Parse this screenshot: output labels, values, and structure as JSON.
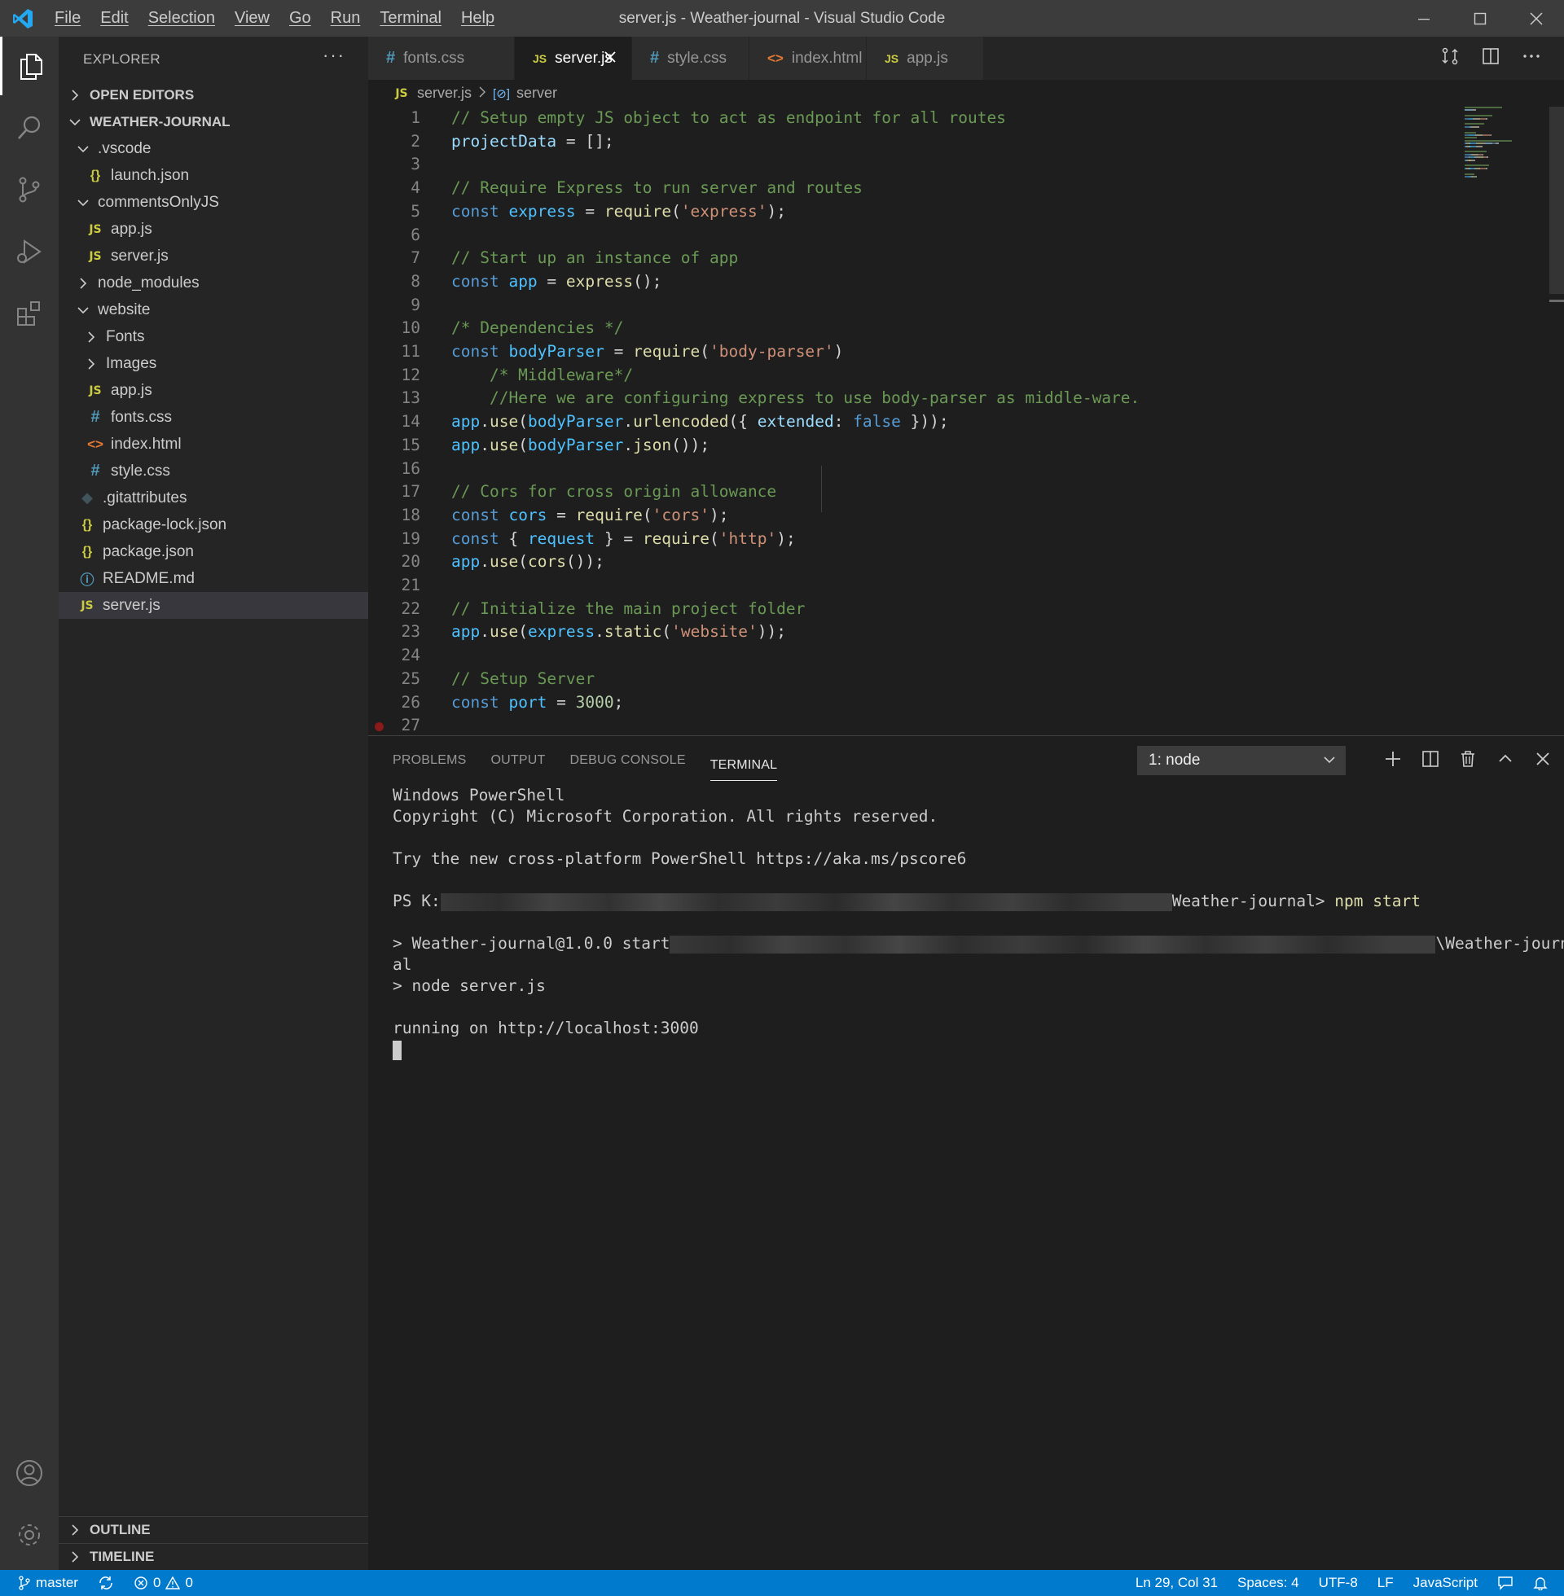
{
  "titlebar": {
    "menu": [
      "File",
      "Edit",
      "Selection",
      "View",
      "Go",
      "Run",
      "Terminal",
      "Help"
    ],
    "title": "server.js - Weather-journal - Visual Studio Code"
  },
  "sidebar": {
    "header": "EXPLORER",
    "more": "···",
    "open_editors": "OPEN EDITORS",
    "project": "WEATHER-JOURNAL",
    "tree": [
      {
        "label": ".vscode",
        "type": "folder-open",
        "indent": 1
      },
      {
        "label": "launch.json",
        "type": "json",
        "indent": 2
      },
      {
        "label": "commentsOnlyJS",
        "type": "folder-open",
        "indent": 1
      },
      {
        "label": "app.js",
        "type": "js",
        "indent": 2
      },
      {
        "label": "server.js",
        "type": "js",
        "indent": 2
      },
      {
        "label": "node_modules",
        "type": "folder-closed",
        "indent": 1
      },
      {
        "label": "website",
        "type": "folder-open",
        "indent": 1
      },
      {
        "label": "Fonts",
        "type": "folder-closed",
        "indent": 2
      },
      {
        "label": "Images",
        "type": "folder-closed",
        "indent": 2
      },
      {
        "label": "app.js",
        "type": "js",
        "indent": 2
      },
      {
        "label": "fonts.css",
        "type": "css",
        "indent": 2
      },
      {
        "label": "index.html",
        "type": "html",
        "indent": 2
      },
      {
        "label": "style.css",
        "type": "css",
        "indent": 2
      },
      {
        "label": ".gitattributes",
        "type": "git",
        "indent": 1
      },
      {
        "label": "package-lock.json",
        "type": "json",
        "indent": 1
      },
      {
        "label": "package.json",
        "type": "json",
        "indent": 1
      },
      {
        "label": "README.md",
        "type": "info",
        "indent": 1
      },
      {
        "label": "server.js",
        "type": "js",
        "indent": 1,
        "selected": true
      }
    ],
    "outline": "OUTLINE",
    "timeline": "TIMELINE"
  },
  "tabs": [
    {
      "label": "fonts.css",
      "type": "css",
      "active": false
    },
    {
      "label": "server.js",
      "type": "js",
      "active": true
    },
    {
      "label": "style.css",
      "type": "css",
      "active": false
    },
    {
      "label": "index.html",
      "type": "html",
      "active": false
    },
    {
      "label": "app.js",
      "type": "js",
      "active": false
    }
  ],
  "breadcrumb": {
    "file": "server.js",
    "symbol": "server"
  },
  "code_lines": [
    [
      [
        "c-com",
        "// Setup empty JS object to act as endpoint for all routes"
      ]
    ],
    [
      [
        "c-var",
        "projectData"
      ],
      [
        "c-txt",
        " = [];"
      ]
    ],
    [],
    [
      [
        "c-com",
        "// Require Express to run server and routes"
      ]
    ],
    [
      [
        "c-kw",
        "const "
      ],
      [
        "c-const",
        "express"
      ],
      [
        "c-txt",
        " = "
      ],
      [
        "c-fn",
        "require"
      ],
      [
        "c-txt",
        "("
      ],
      [
        "c-str",
        "'express'"
      ],
      [
        "c-txt",
        ");"
      ]
    ],
    [],
    [
      [
        "c-com",
        "// Start up an instance of app"
      ]
    ],
    [
      [
        "c-kw",
        "const "
      ],
      [
        "c-const",
        "app"
      ],
      [
        "c-txt",
        " = "
      ],
      [
        "c-fn",
        "express"
      ],
      [
        "c-txt",
        "();"
      ]
    ],
    [],
    [
      [
        "c-com",
        "/* Dependencies */"
      ]
    ],
    [
      [
        "c-kw",
        "const "
      ],
      [
        "c-const",
        "bodyParser"
      ],
      [
        "c-txt",
        " = "
      ],
      [
        "c-fn",
        "require"
      ],
      [
        "c-txt",
        "("
      ],
      [
        "c-str",
        "'body-parser'"
      ],
      [
        "c-txt",
        ")"
      ]
    ],
    [
      [
        "c-com",
        "    /* Middleware*/"
      ]
    ],
    [
      [
        "c-com",
        "    //Here we are configuring express to use body-parser as middle-ware."
      ]
    ],
    [
      [
        "c-const",
        "app"
      ],
      [
        "c-txt",
        "."
      ],
      [
        "c-fn",
        "use"
      ],
      [
        "c-txt",
        "("
      ],
      [
        "c-const",
        "bodyParser"
      ],
      [
        "c-txt",
        "."
      ],
      [
        "c-fn",
        "urlencoded"
      ],
      [
        "c-txt",
        "({ "
      ],
      [
        "c-var",
        "extended"
      ],
      [
        "c-txt",
        ": "
      ],
      [
        "c-kw",
        "false"
      ],
      [
        "c-txt",
        " }));"
      ]
    ],
    [
      [
        "c-const",
        "app"
      ],
      [
        "c-txt",
        "."
      ],
      [
        "c-fn",
        "use"
      ],
      [
        "c-txt",
        "("
      ],
      [
        "c-const",
        "bodyParser"
      ],
      [
        "c-txt",
        "."
      ],
      [
        "c-fn",
        "json"
      ],
      [
        "c-txt",
        "());"
      ]
    ],
    [],
    [
      [
        "c-com",
        "// Cors for cross origin allowance"
      ]
    ],
    [
      [
        "c-kw",
        "const "
      ],
      [
        "c-const",
        "cors"
      ],
      [
        "c-txt",
        " = "
      ],
      [
        "c-fn",
        "require"
      ],
      [
        "c-txt",
        "("
      ],
      [
        "c-str",
        "'cors'"
      ],
      [
        "c-txt",
        ");"
      ]
    ],
    [
      [
        "c-kw",
        "const "
      ],
      [
        "c-txt",
        "{ "
      ],
      [
        "c-const",
        "request"
      ],
      [
        "c-txt",
        " } = "
      ],
      [
        "c-fn",
        "require"
      ],
      [
        "c-txt",
        "("
      ],
      [
        "c-str",
        "'http'"
      ],
      [
        "c-txt",
        ");"
      ]
    ],
    [
      [
        "c-const",
        "app"
      ],
      [
        "c-txt",
        "."
      ],
      [
        "c-fn",
        "use"
      ],
      [
        "c-txt",
        "("
      ],
      [
        "c-fn",
        "cors"
      ],
      [
        "c-txt",
        "());"
      ]
    ],
    [],
    [
      [
        "c-com",
        "// Initialize the main project folder"
      ]
    ],
    [
      [
        "c-const",
        "app"
      ],
      [
        "c-txt",
        "."
      ],
      [
        "c-fn",
        "use"
      ],
      [
        "c-txt",
        "("
      ],
      [
        "c-const",
        "express"
      ],
      [
        "c-txt",
        "."
      ],
      [
        "c-fn",
        "static"
      ],
      [
        "c-txt",
        "("
      ],
      [
        "c-str",
        "'website'"
      ],
      [
        "c-txt",
        "));"
      ]
    ],
    [],
    [
      [
        "c-com",
        "// Setup Server"
      ]
    ],
    [
      [
        "c-kw",
        "const "
      ],
      [
        "c-const",
        "port"
      ],
      [
        "c-txt",
        " = "
      ],
      [
        "c-num",
        "3000"
      ],
      [
        "c-txt",
        ";"
      ]
    ],
    []
  ],
  "panel": {
    "tabs": [
      "PROBLEMS",
      "OUTPUT",
      "DEBUG CONSOLE",
      "TERMINAL"
    ],
    "active_tab": "TERMINAL",
    "terminal_select": "1: node",
    "terminal": {
      "l1": "Windows PowerShell",
      "l2": "Copyright (C) Microsoft Corporation. All rights reserved.",
      "l3": "Try the new cross-platform PowerShell https://aka.ms/pscore6",
      "prompt_start": "PS K:",
      "prompt_end": "Weather-journal> ",
      "npm": "npm start",
      "start_line_a": "> Weather-journal@1.0.0 start",
      "start_line_b": "\\Weather-journ",
      "start_line_c": "al",
      "node_line": "> node server.js",
      "running": "running on http://localhost:3000"
    }
  },
  "statusbar": {
    "branch": "master",
    "errors": "0",
    "warnings": "0",
    "position": "Ln 29, Col 31",
    "spaces": "Spaces: 4",
    "encoding": "UTF-8",
    "eol": "LF",
    "language": "JavaScript"
  },
  "colors": {
    "accent": "#007acc",
    "titlebar": "#3c3c3c",
    "activitybar": "#333333",
    "sidebar": "#252526",
    "editor": "#1e1e1e"
  }
}
